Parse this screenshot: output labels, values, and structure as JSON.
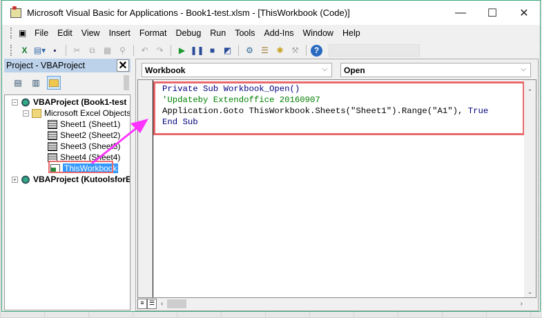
{
  "window": {
    "title": "Microsoft Visual Basic for Applications - Book1-test.xlsm - [ThisWorkbook (Code)]",
    "controls": [
      "—",
      "☐",
      "✕"
    ]
  },
  "menu": [
    "File",
    "Edit",
    "View",
    "Insert",
    "Format",
    "Debug",
    "Run",
    "Tools",
    "Add-Ins",
    "Window",
    "Help"
  ],
  "toolbar": [
    "excel-icon",
    "insert-userform-icon",
    "save-icon",
    "cut-icon",
    "copy-icon",
    "paste-icon",
    "find-icon",
    "undo-icon",
    "redo-icon",
    "run-icon",
    "break-icon",
    "reset-icon",
    "design-mode-icon",
    "project-explorer-icon",
    "properties-icon",
    "object-browser-icon",
    "toolbox-icon",
    "help-icon"
  ],
  "project": {
    "title": "Project - VBAProject",
    "close": "✕",
    "tree": {
      "root1": "VBAProject (Book1-test",
      "folder": "Microsoft Excel Objects",
      "sheets": [
        "Sheet1 (Sheet1)",
        "Sheet2 (Sheet2)",
        "Sheet3 (Sheet3)",
        "Sheet4 (Sheet4)"
      ],
      "thisworkbook": "ThisWorkbook",
      "root2": "VBAProject (KutoolsforE"
    }
  },
  "code": {
    "object": "Workbook",
    "procedure": "Open",
    "lines": {
      "l1a": "Private Sub",
      "l1b": " Workbook_Open()",
      "l2": "'Updateby Extendoffice 20160907",
      "l3a": "Application.Goto ThisWorkbook.Sheets(\"Sheet1\").Range(\"A1\"), ",
      "l3b": "True",
      "l4": "End Sub"
    }
  },
  "colors": {
    "highlight": "#e8696b",
    "arrow": "#ff33ff",
    "keyword": "#00007f",
    "comment": "#007f00"
  }
}
